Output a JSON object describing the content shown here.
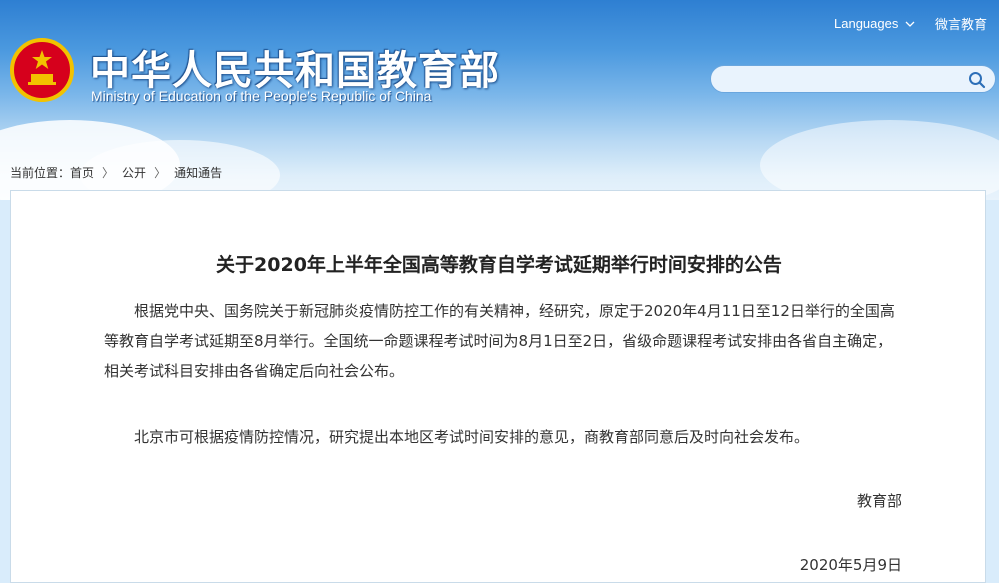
{
  "header": {
    "title_cn": "中华人民共和国教育部",
    "title_en": "Ministry of Education of the People's Republic of China",
    "languages_label": "Languages",
    "weibo_label": "微言教育",
    "search_placeholder": ""
  },
  "breadcrumb": {
    "prefix": "当前位置：",
    "items": [
      "首页",
      "公开",
      "通知通告"
    ]
  },
  "article": {
    "title": "关于2020年上半年全国高等教育自学考试延期举行时间安排的公告",
    "paragraphs": [
      "根据党中央、国务院关于新冠肺炎疫情防控工作的有关精神，经研究，原定于2020年4月11日至12日举行的全国高等教育自学考试延期至8月举行。全国统一命题课程考试时间为8月1日至2日，省级命题课程考试安排由各省自主确定，相关考试科目安排由各省确定后向社会公布。",
      "北京市可根据疫情防控情况，研究提出本地区考试时间安排的意见，商教育部同意后及时向社会发布。"
    ],
    "signature": "教育部",
    "date": "2020年5月9日"
  },
  "colors": {
    "header_top": "#2e7fd2",
    "header_bottom": "#e8f3fc",
    "emblem_red": "#d6001c",
    "emblem_gold": "#f2c200"
  },
  "icons": [
    "national-emblem-icon",
    "chevron-down-icon",
    "search-icon"
  ]
}
